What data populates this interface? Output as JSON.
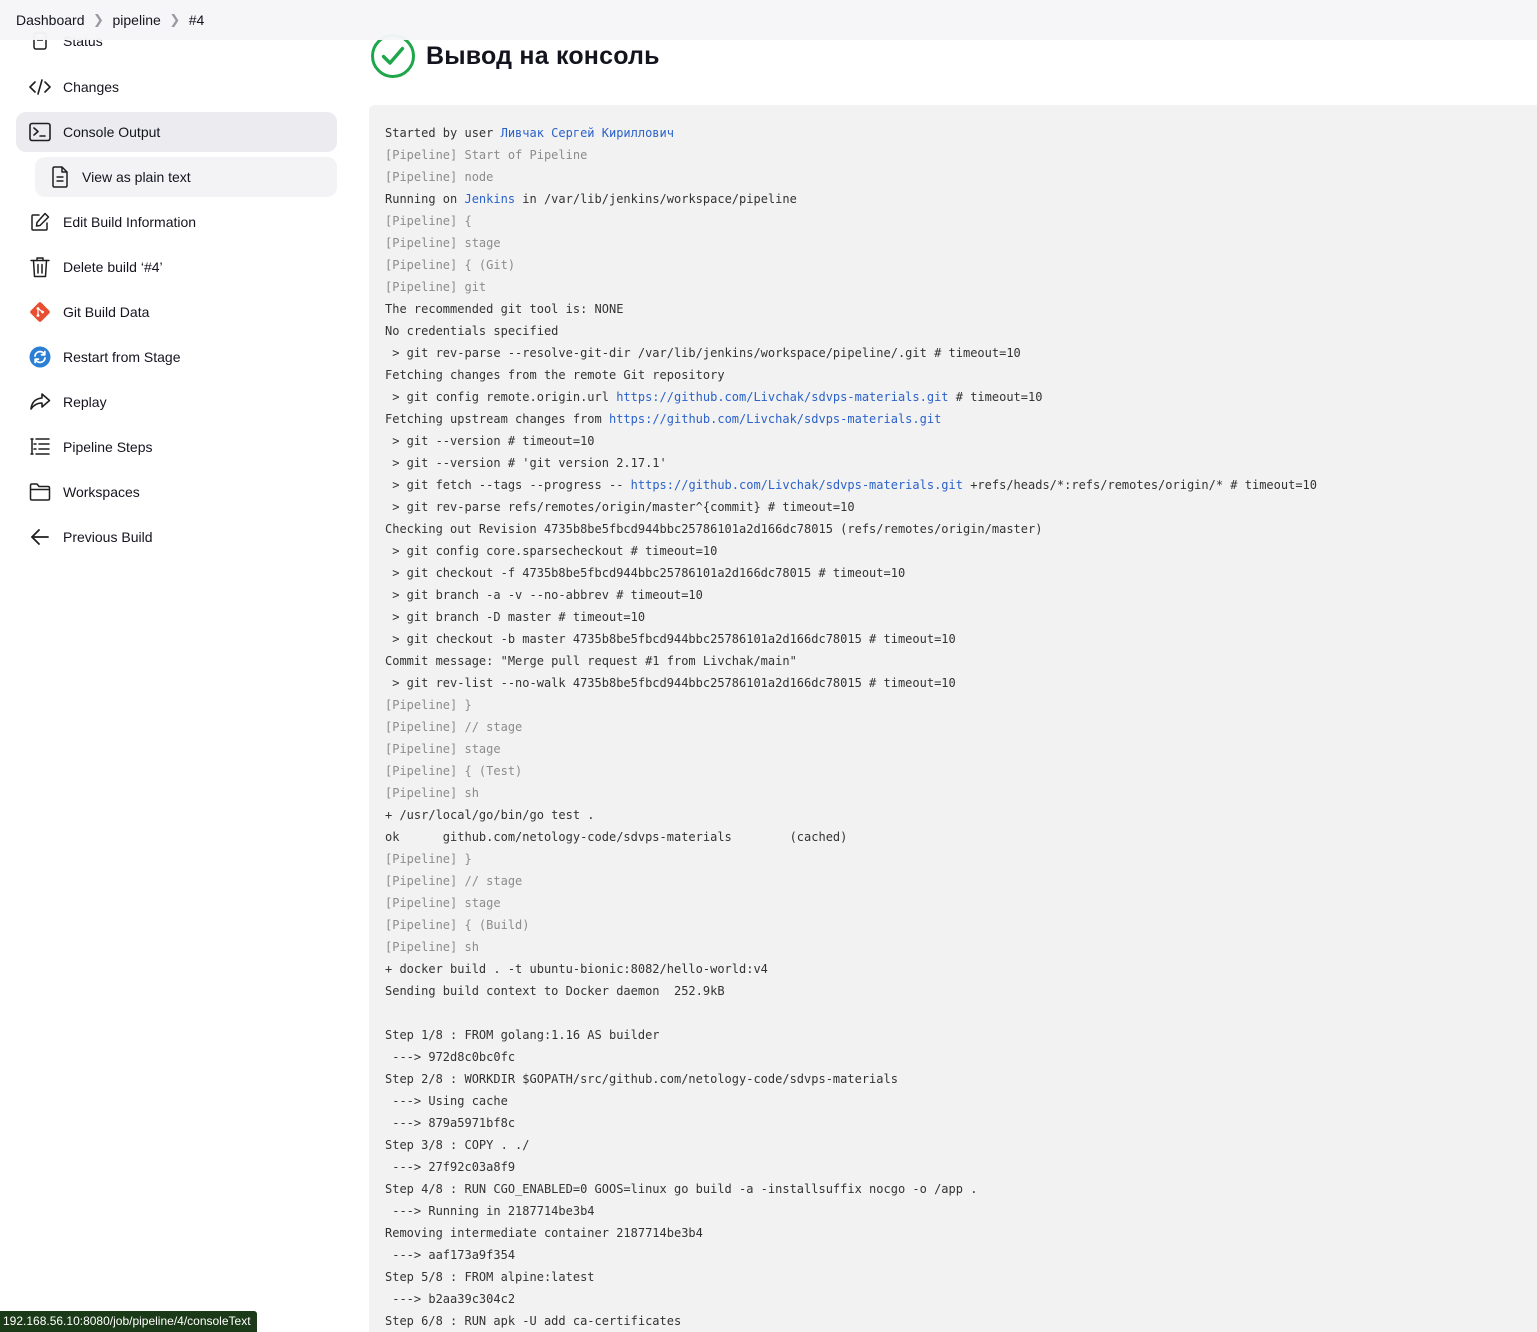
{
  "breadcrumb": {
    "items": [
      "Dashboard",
      "pipeline",
      "#4"
    ]
  },
  "sidebar": {
    "items": [
      {
        "label": "Status",
        "icon": "status-icon"
      },
      {
        "label": "Changes",
        "icon": "code-icon"
      },
      {
        "label": "Console Output",
        "icon": "terminal-icon",
        "active": true
      },
      {
        "label": "View as plain text",
        "icon": "document-icon",
        "sub": true
      },
      {
        "label": "Edit Build Information",
        "icon": "edit-icon"
      },
      {
        "label": "Delete build ‘#4’",
        "icon": "trash-icon"
      },
      {
        "label": "Git Build Data",
        "icon": "git-icon"
      },
      {
        "label": "Restart from Stage",
        "icon": "restart-icon"
      },
      {
        "label": "Replay",
        "icon": "replay-icon"
      },
      {
        "label": "Pipeline Steps",
        "icon": "list-icon"
      },
      {
        "label": "Workspaces",
        "icon": "folder-icon"
      },
      {
        "label": "Previous Build",
        "icon": "arrow-left-icon"
      }
    ]
  },
  "main": {
    "title": "Вывод на консоль",
    "status": "success"
  },
  "console": {
    "lines": [
      {
        "segments": [
          {
            "t": "Started by user "
          },
          {
            "t": "Ливчак Сергей Кириллович",
            "link": true
          }
        ]
      },
      {
        "segments": [
          {
            "t": "[Pipeline] Start of Pipeline"
          }
        ],
        "pipeline": true
      },
      {
        "segments": [
          {
            "t": "[Pipeline] node"
          }
        ],
        "pipeline": true
      },
      {
        "segments": [
          {
            "t": "Running on "
          },
          {
            "t": "Jenkins",
            "link": true
          },
          {
            "t": " in /var/lib/jenkins/workspace/pipeline"
          }
        ]
      },
      {
        "segments": [
          {
            "t": "[Pipeline] {"
          }
        ],
        "pipeline": true
      },
      {
        "segments": [
          {
            "t": "[Pipeline] stage"
          }
        ],
        "pipeline": true
      },
      {
        "segments": [
          {
            "t": "[Pipeline] { (Git)"
          }
        ],
        "pipeline": true
      },
      {
        "segments": [
          {
            "t": "[Pipeline] git"
          }
        ],
        "pipeline": true
      },
      {
        "segments": [
          {
            "t": "The recommended git tool is: NONE"
          }
        ]
      },
      {
        "segments": [
          {
            "t": "No credentials specified"
          }
        ]
      },
      {
        "segments": [
          {
            "t": " > git rev-parse --resolve-git-dir /var/lib/jenkins/workspace/pipeline/.git # timeout=10"
          }
        ]
      },
      {
        "segments": [
          {
            "t": "Fetching changes from the remote Git repository"
          }
        ]
      },
      {
        "segments": [
          {
            "t": " > git config remote.origin.url "
          },
          {
            "t": "https://github.com/Livchak/sdvps-materials.git",
            "link": true
          },
          {
            "t": " # timeout=10"
          }
        ]
      },
      {
        "segments": [
          {
            "t": "Fetching upstream changes from "
          },
          {
            "t": "https://github.com/Livchak/sdvps-materials.git",
            "link": true
          }
        ]
      },
      {
        "segments": [
          {
            "t": " > git --version # timeout=10"
          }
        ]
      },
      {
        "segments": [
          {
            "t": " > git --version # 'git version 2.17.1'"
          }
        ]
      },
      {
        "segments": [
          {
            "t": " > git fetch --tags --progress -- "
          },
          {
            "t": "https://github.com/Livchak/sdvps-materials.git",
            "link": true
          },
          {
            "t": " +refs/heads/*:refs/remotes/origin/* # timeout=10"
          }
        ]
      },
      {
        "segments": [
          {
            "t": " > git rev-parse refs/remotes/origin/master^{commit} # timeout=10"
          }
        ]
      },
      {
        "segments": [
          {
            "t": "Checking out Revision 4735b8be5fbcd944bbc25786101a2d166dc78015 (refs/remotes/origin/master)"
          }
        ]
      },
      {
        "segments": [
          {
            "t": " > git config core.sparsecheckout # timeout=10"
          }
        ]
      },
      {
        "segments": [
          {
            "t": " > git checkout -f 4735b8be5fbcd944bbc25786101a2d166dc78015 # timeout=10"
          }
        ]
      },
      {
        "segments": [
          {
            "t": " > git branch -a -v --no-abbrev # timeout=10"
          }
        ]
      },
      {
        "segments": [
          {
            "t": " > git branch -D master # timeout=10"
          }
        ]
      },
      {
        "segments": [
          {
            "t": " > git checkout -b master 4735b8be5fbcd944bbc25786101a2d166dc78015 # timeout=10"
          }
        ]
      },
      {
        "segments": [
          {
            "t": "Commit message: \"Merge pull request #1 from Livchak/main\""
          }
        ]
      },
      {
        "segments": [
          {
            "t": " > git rev-list --no-walk 4735b8be5fbcd944bbc25786101a2d166dc78015 # timeout=10"
          }
        ]
      },
      {
        "segments": [
          {
            "t": "[Pipeline] }"
          }
        ],
        "pipeline": true
      },
      {
        "segments": [
          {
            "t": "[Pipeline] // stage"
          }
        ],
        "pipeline": true
      },
      {
        "segments": [
          {
            "t": "[Pipeline] stage"
          }
        ],
        "pipeline": true
      },
      {
        "segments": [
          {
            "t": "[Pipeline] { (Test)"
          }
        ],
        "pipeline": true
      },
      {
        "segments": [
          {
            "t": "[Pipeline] sh"
          }
        ],
        "pipeline": true
      },
      {
        "segments": [
          {
            "t": "+ /usr/local/go/bin/go test ."
          }
        ]
      },
      {
        "segments": [
          {
            "t": "ok  \tgithub.com/netology-code/sdvps-materials\t(cached)"
          }
        ]
      },
      {
        "segments": [
          {
            "t": "[Pipeline] }"
          }
        ],
        "pipeline": true
      },
      {
        "segments": [
          {
            "t": "[Pipeline] // stage"
          }
        ],
        "pipeline": true
      },
      {
        "segments": [
          {
            "t": "[Pipeline] stage"
          }
        ],
        "pipeline": true
      },
      {
        "segments": [
          {
            "t": "[Pipeline] { (Build)"
          }
        ],
        "pipeline": true
      },
      {
        "segments": [
          {
            "t": "[Pipeline] sh"
          }
        ],
        "pipeline": true
      },
      {
        "segments": [
          {
            "t": "+ docker build . -t ubuntu-bionic:8082/hello-world:v4"
          }
        ]
      },
      {
        "segments": [
          {
            "t": "Sending build context to Docker daemon  252.9kB"
          }
        ]
      },
      {
        "segments": [
          {
            "t": ""
          }
        ]
      },
      {
        "segments": [
          {
            "t": "Step 1/8 : FROM golang:1.16 AS builder"
          }
        ]
      },
      {
        "segments": [
          {
            "t": " ---> 972d8c0bc0fc"
          }
        ]
      },
      {
        "segments": [
          {
            "t": "Step 2/8 : WORKDIR $GOPATH/src/github.com/netology-code/sdvps-materials"
          }
        ]
      },
      {
        "segments": [
          {
            "t": " ---> Using cache"
          }
        ]
      },
      {
        "segments": [
          {
            "t": " ---> 879a5971bf8c"
          }
        ]
      },
      {
        "segments": [
          {
            "t": "Step 3/8 : COPY . ./"
          }
        ]
      },
      {
        "segments": [
          {
            "t": " ---> 27f92c03a8f9"
          }
        ]
      },
      {
        "segments": [
          {
            "t": "Step 4/8 : RUN CGO_ENABLED=0 GOOS=linux go build -a -installsuffix nocgo -o /app ."
          }
        ]
      },
      {
        "segments": [
          {
            "t": " ---> Running in 2187714be3b4"
          }
        ]
      },
      {
        "segments": [
          {
            "t": "Removing intermediate container 2187714be3b4"
          }
        ]
      },
      {
        "segments": [
          {
            "t": " ---> aaf173a9f354"
          }
        ]
      },
      {
        "segments": [
          {
            "t": "Step 5/8 : FROM alpine:latest"
          }
        ]
      },
      {
        "segments": [
          {
            "t": " ---> b2aa39c304c2"
          }
        ]
      },
      {
        "segments": [
          {
            "t": "Step 6/8 : RUN apk -U add ca-certificates"
          }
        ]
      }
    ]
  },
  "status_bar": {
    "url": "192.168.56.10:8080/job/pipeline/4/consoleText"
  },
  "colors": {
    "link": "#2b62c9",
    "success": "#1ea64b",
    "console_bg": "#f2f2f2",
    "pipeline_text": "#8c8c8c"
  }
}
